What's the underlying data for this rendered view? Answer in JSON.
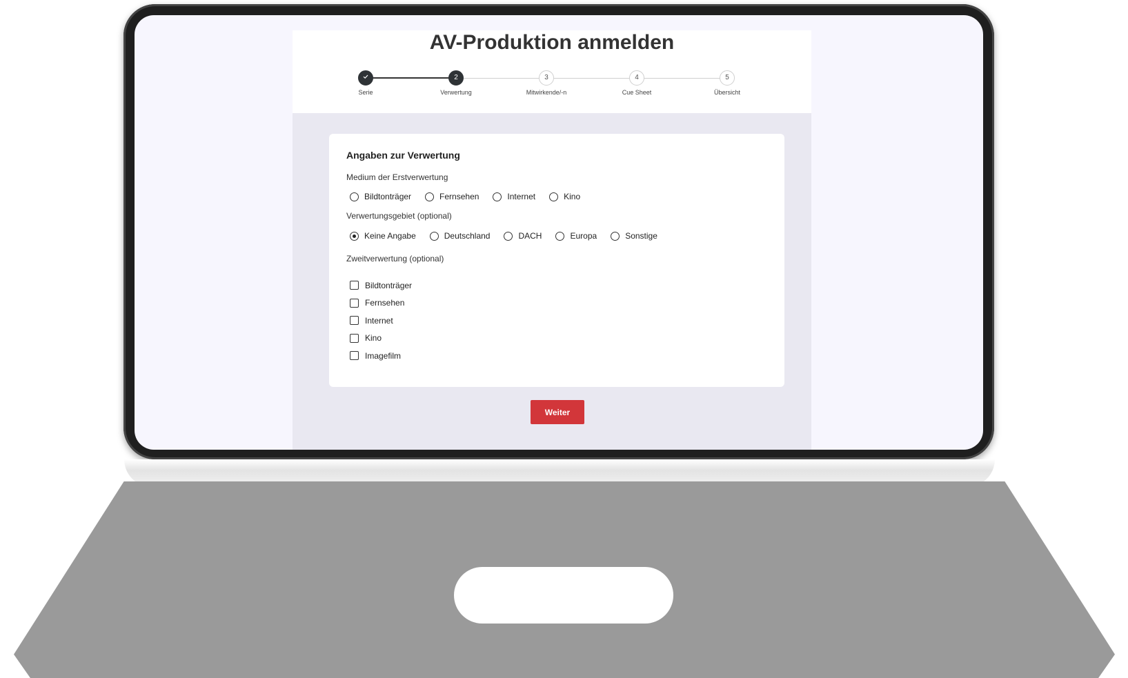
{
  "page": {
    "title": "AV-Produktion anmelden"
  },
  "stepper": {
    "steps": [
      {
        "number": "",
        "label": "Serie",
        "status": "completed",
        "icon": "check-icon"
      },
      {
        "number": "2",
        "label": "Verwertung",
        "status": "active"
      },
      {
        "number": "3",
        "label": "Mitwirkende/-n",
        "status": "pending"
      },
      {
        "number": "4",
        "label": "Cue Sheet",
        "status": "pending"
      },
      {
        "number": "5",
        "label": "Übersicht",
        "status": "pending"
      }
    ]
  },
  "form": {
    "section_title": "Angaben zur Verwertung",
    "medium": {
      "label": "Medium der Erstverwertung",
      "options": [
        {
          "label": "Bildtonträger",
          "checked": false
        },
        {
          "label": "Fernsehen",
          "checked": false
        },
        {
          "label": "Internet",
          "checked": false
        },
        {
          "label": "Kino",
          "checked": false
        }
      ]
    },
    "gebiet": {
      "label": "Verwertungsgebiet (optional)",
      "options": [
        {
          "label": "Keine Angabe",
          "checked": true
        },
        {
          "label": "Deutschland",
          "checked": false
        },
        {
          "label": "DACH",
          "checked": false
        },
        {
          "label": "Europa",
          "checked": false
        },
        {
          "label": "Sonstige",
          "checked": false
        }
      ]
    },
    "zweitverwertung": {
      "label": "Zweitverwertung (optional)",
      "options": [
        {
          "label": "Bildtonträger",
          "checked": false
        },
        {
          "label": "Fernsehen",
          "checked": false
        },
        {
          "label": "Internet",
          "checked": false
        },
        {
          "label": "Kino",
          "checked": false
        },
        {
          "label": "Imagefilm",
          "checked": false
        }
      ]
    }
  },
  "actions": {
    "next_label": "Weiter"
  },
  "colors": {
    "primary_button": "#d2363a",
    "active_step": "#2f3336",
    "page_background": "#e9e8f1"
  }
}
